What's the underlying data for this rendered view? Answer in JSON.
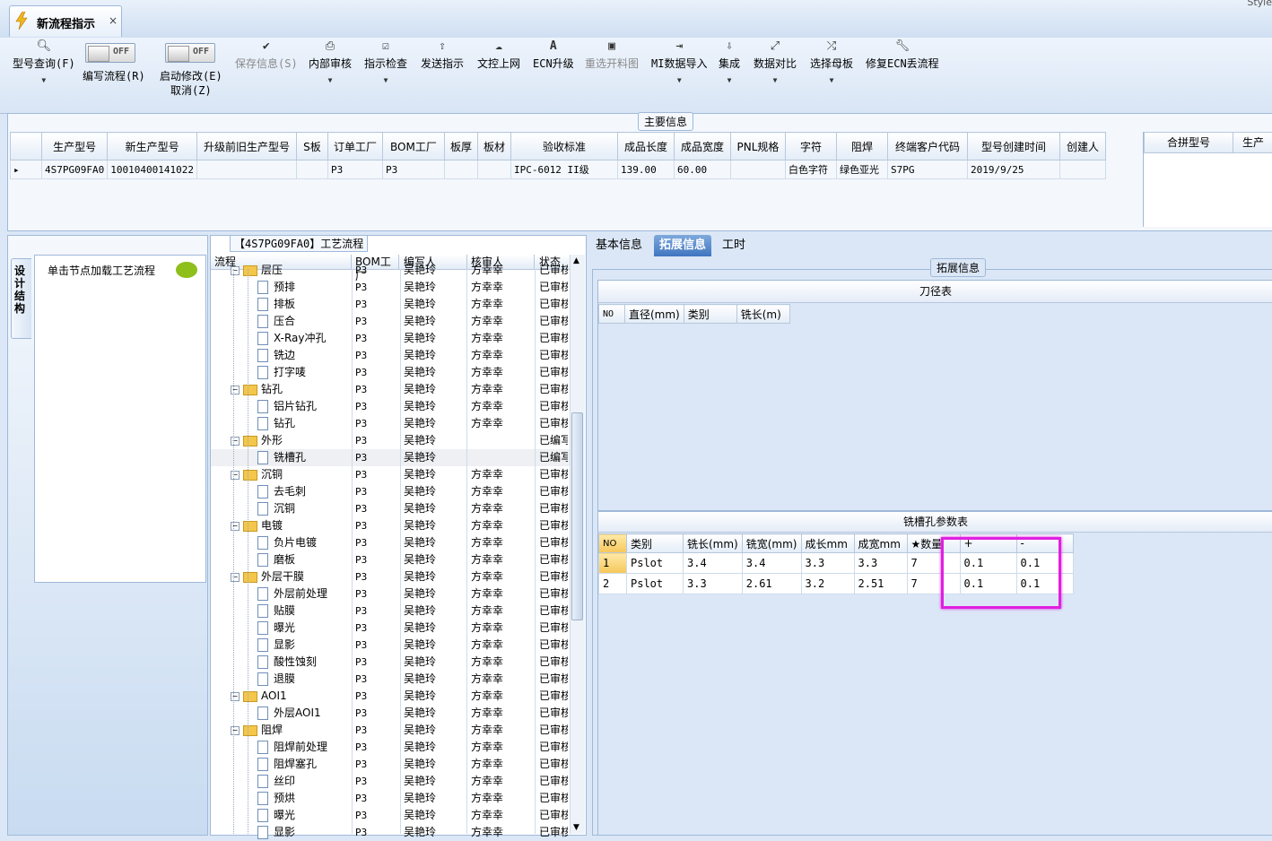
{
  "window": {
    "tab_title": "新流程指示",
    "close_glyph": "×",
    "style_text": "Style"
  },
  "toolbar": {
    "buttons": [
      {
        "label": "型号查询(F)",
        "icon": "search-icon",
        "has_dropdown": true
      },
      {
        "label": "编写流程(R)",
        "toggle": "OFF"
      },
      {
        "label": "启动修改(E)",
        "label2": "取消(Z)",
        "toggle": "OFF"
      },
      {
        "label": "保存信息(S)",
        "icon": "check-icon",
        "disabled": true
      },
      {
        "label": "内部审核",
        "icon": "printer-icon",
        "has_dropdown": true
      },
      {
        "label": "指示检查",
        "icon": "checkbox-icon",
        "has_dropdown": true
      },
      {
        "label": "发送指示",
        "icon": "upload-icon"
      },
      {
        "label": "文控上网",
        "icon": "cloud-upload-icon"
      },
      {
        "label": "ECN升级",
        "icon": "font-a-icon"
      },
      {
        "label": "重选开料图",
        "icon": "image-icon",
        "disabled": true
      },
      {
        "label": "MI数据导入",
        "icon": "import-icon",
        "has_dropdown": true
      },
      {
        "label": "集成",
        "icon": "download-icon",
        "has_dropdown": true
      },
      {
        "label": "数据对比",
        "icon": "compare-icon",
        "has_dropdown": true
      },
      {
        "label": "选择母板",
        "icon": "shuffle-icon",
        "has_dropdown": true
      },
      {
        "label": "修复ECN丢流程",
        "icon": "wrench-icon"
      }
    ],
    "toggle_off": "OFF"
  },
  "main_info": {
    "title": "主要信息",
    "columns": [
      "生产型号",
      "新生产型号",
      "升级前旧生产型号",
      "S板",
      "订单工厂",
      "BOM工厂",
      "板厚",
      "板材",
      "验收标准",
      "成品长度",
      "成品宽度",
      "PNL规格",
      "字符",
      "阻焊",
      "终端客户代码",
      "型号创建时间",
      "创建人"
    ],
    "rows": [
      [
        "4S7PG09FA0",
        "10010400141022",
        "",
        "",
        "P3",
        "P3",
        "",
        "",
        "IPC-6012 II级",
        "139.00",
        "60.00",
        "",
        "白色字符",
        "绿色亚光",
        "S7PG",
        "2019/9/25",
        ""
      ]
    ],
    "side_columns": [
      "合拼型号",
      "生产"
    ]
  },
  "left": {
    "vertical_tab": "设计结构",
    "hint": "单击节点加载工艺流程"
  },
  "process": {
    "title": "【4S7PG09FA0】工艺流程",
    "columns": [
      "流程",
      "BOM工厂",
      "编写人",
      "核审人",
      "状态"
    ],
    "rows": [
      {
        "name": "层压",
        "level": 1,
        "bom": "P3",
        "writer": "吴艳玲",
        "reviewer": "方幸幸",
        "status": "已审核",
        "partial": true
      },
      {
        "name": "预排",
        "level": 2,
        "bom": "P3",
        "writer": "吴艳玲",
        "reviewer": "方幸幸",
        "status": "已审核"
      },
      {
        "name": "排板",
        "level": 2,
        "bom": "P3",
        "writer": "吴艳玲",
        "reviewer": "方幸幸",
        "status": "已审核"
      },
      {
        "name": "压合",
        "level": 2,
        "bom": "P3",
        "writer": "吴艳玲",
        "reviewer": "方幸幸",
        "status": "已审核"
      },
      {
        "name": "X-Ray冲孔",
        "level": 2,
        "bom": "P3",
        "writer": "吴艳玲",
        "reviewer": "方幸幸",
        "status": "已审核"
      },
      {
        "name": "铣边",
        "level": 2,
        "bom": "P3",
        "writer": "吴艳玲",
        "reviewer": "方幸幸",
        "status": "已审核"
      },
      {
        "name": "打字唛",
        "level": 2,
        "bom": "P3",
        "writer": "吴艳玲",
        "reviewer": "方幸幸",
        "status": "已审核"
      },
      {
        "name": "钻孔",
        "level": 1,
        "bom": "P3",
        "writer": "吴艳玲",
        "reviewer": "方幸幸",
        "status": "已审核"
      },
      {
        "name": "铝片钻孔",
        "level": 2,
        "bom": "P3",
        "writer": "吴艳玲",
        "reviewer": "方幸幸",
        "status": "已审核"
      },
      {
        "name": "钻孔",
        "level": 2,
        "bom": "P3",
        "writer": "吴艳玲",
        "reviewer": "方幸幸",
        "status": "已审核"
      },
      {
        "name": "外形",
        "level": 1,
        "bom": "P3",
        "writer": "吴艳玲",
        "reviewer": "",
        "status": "已编写"
      },
      {
        "name": "铣槽孔",
        "level": 2,
        "bom": "P3",
        "writer": "吴艳玲",
        "reviewer": "",
        "status": "已编写",
        "selected": true
      },
      {
        "name": "沉铜",
        "level": 1,
        "bom": "P3",
        "writer": "吴艳玲",
        "reviewer": "方幸幸",
        "status": "已审核"
      },
      {
        "name": "去毛刺",
        "level": 2,
        "bom": "P3",
        "writer": "吴艳玲",
        "reviewer": "方幸幸",
        "status": "已审核"
      },
      {
        "name": "沉铜",
        "level": 2,
        "bom": "P3",
        "writer": "吴艳玲",
        "reviewer": "方幸幸",
        "status": "已审核"
      },
      {
        "name": "电镀",
        "level": 1,
        "bom": "P3",
        "writer": "吴艳玲",
        "reviewer": "方幸幸",
        "status": "已审核"
      },
      {
        "name": "负片电镀",
        "level": 2,
        "bom": "P3",
        "writer": "吴艳玲",
        "reviewer": "方幸幸",
        "status": "已审核"
      },
      {
        "name": "磨板",
        "level": 2,
        "bom": "P3",
        "writer": "吴艳玲",
        "reviewer": "方幸幸",
        "status": "已审核"
      },
      {
        "name": "外层干膜",
        "level": 1,
        "bom": "P3",
        "writer": "吴艳玲",
        "reviewer": "方幸幸",
        "status": "已审核"
      },
      {
        "name": "外层前处理",
        "level": 2,
        "bom": "P3",
        "writer": "吴艳玲",
        "reviewer": "方幸幸",
        "status": "已审核"
      },
      {
        "name": "贴膜",
        "level": 2,
        "bom": "P3",
        "writer": "吴艳玲",
        "reviewer": "方幸幸",
        "status": "已审核"
      },
      {
        "name": "曝光",
        "level": 2,
        "bom": "P3",
        "writer": "吴艳玲",
        "reviewer": "方幸幸",
        "status": "已审核"
      },
      {
        "name": "显影",
        "level": 2,
        "bom": "P3",
        "writer": "吴艳玲",
        "reviewer": "方幸幸",
        "status": "已审核"
      },
      {
        "name": "酸性蚀刻",
        "level": 2,
        "bom": "P3",
        "writer": "吴艳玲",
        "reviewer": "方幸幸",
        "status": "已审核"
      },
      {
        "name": "退膜",
        "level": 2,
        "bom": "P3",
        "writer": "吴艳玲",
        "reviewer": "方幸幸",
        "status": "已审核"
      },
      {
        "name": "AOI1",
        "level": 1,
        "bom": "P3",
        "writer": "吴艳玲",
        "reviewer": "方幸幸",
        "status": "已审核"
      },
      {
        "name": "外层AOI1",
        "level": 2,
        "bom": "P3",
        "writer": "吴艳玲",
        "reviewer": "方幸幸",
        "status": "已审核"
      },
      {
        "name": "阻焊",
        "level": 1,
        "bom": "P3",
        "writer": "吴艳玲",
        "reviewer": "方幸幸",
        "status": "已审核"
      },
      {
        "name": "阻焊前处理",
        "level": 2,
        "bom": "P3",
        "writer": "吴艳玲",
        "reviewer": "方幸幸",
        "status": "已审核"
      },
      {
        "name": "阻焊塞孔",
        "level": 2,
        "bom": "P3",
        "writer": "吴艳玲",
        "reviewer": "方幸幸",
        "status": "已审核"
      },
      {
        "name": "丝印",
        "level": 2,
        "bom": "P3",
        "writer": "吴艳玲",
        "reviewer": "方幸幸",
        "status": "已审核"
      },
      {
        "name": "预烘",
        "level": 2,
        "bom": "P3",
        "writer": "吴艳玲",
        "reviewer": "方幸幸",
        "status": "已审核"
      },
      {
        "name": "曝光",
        "level": 2,
        "bom": "P3",
        "writer": "吴艳玲",
        "reviewer": "方幸幸",
        "status": "已审核"
      },
      {
        "name": "显影",
        "level": 2,
        "bom": "P3",
        "writer": "吴艳玲",
        "reviewer": "方幸幸",
        "status": "已审核",
        "partial": true
      }
    ]
  },
  "right": {
    "tabs": [
      "基本信息",
      "拓展信息",
      "工时"
    ],
    "active_tab": "拓展信息",
    "group_title": "拓展信息",
    "cutter_table": {
      "title": "刀径表",
      "columns": [
        "NO",
        "直径(mm)",
        "类别",
        "铣长(m)"
      ],
      "rows": []
    },
    "slot_table": {
      "title": "铣槽孔参数表",
      "columns": [
        "NO",
        "类别",
        "铣长(mm)",
        "铣宽(mm)",
        "成长mm",
        "成宽mm",
        "★数量",
        "+",
        "-"
      ],
      "rows": [
        [
          "1",
          "Pslot",
          "3.4",
          "3.4",
          "3.3",
          "3.3",
          "7",
          "0.1",
          "0.1"
        ],
        [
          "2",
          "Pslot",
          "3.3",
          "2.61",
          "3.2",
          "2.51",
          "7",
          "0.1",
          "0.1"
        ]
      ]
    },
    "highlight_color": "#e020e0"
  }
}
